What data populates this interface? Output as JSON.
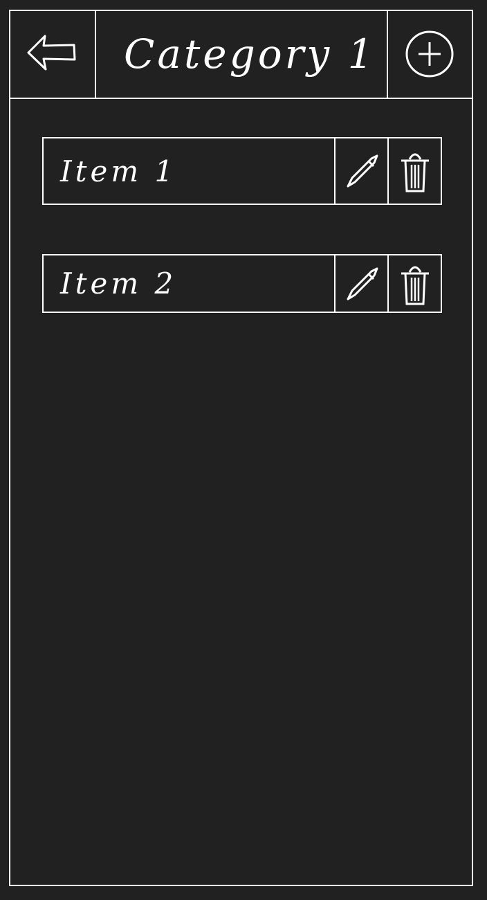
{
  "header": {
    "title": "Category 1",
    "back_icon": "arrow-left-icon",
    "add_icon": "plus-circle-icon"
  },
  "items": [
    {
      "label": "Item 1",
      "edit_icon": "pencil-icon",
      "delete_icon": "trash-icon"
    },
    {
      "label": "Item 2",
      "edit_icon": "pencil-icon",
      "delete_icon": "trash-icon"
    }
  ],
  "colors": {
    "background": "#212121",
    "stroke": "#ffffff"
  }
}
